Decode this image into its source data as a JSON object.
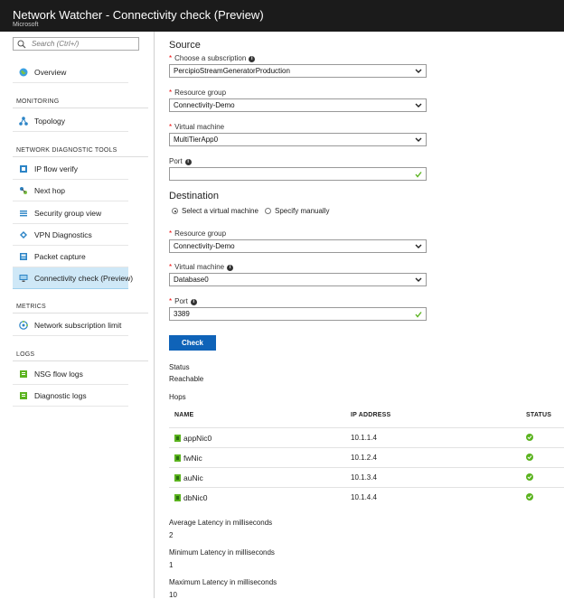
{
  "window": {
    "title": "Network Watcher - Connectivity check (Preview)",
    "subtitle": "Microsoft"
  },
  "sidebar": {
    "search_placeholder": "Search (Ctrl+/)",
    "overview": "Overview",
    "sections": {
      "monitoring": "MONITORING",
      "diagnostic": "NETWORK DIAGNOSTIC TOOLS",
      "metrics": "METRICS",
      "logs": "LOGS"
    },
    "items": {
      "topology": "Topology",
      "ip_flow_verify": "IP flow verify",
      "next_hop": "Next hop",
      "security_group_view": "Security group view",
      "vpn_diagnostics": "VPN Diagnostics",
      "packet_capture": "Packet capture",
      "connectivity_check": "Connectivity check (Preview)",
      "network_subscription_limit": "Network subscription limit",
      "nsg_flow_logs": "NSG flow logs",
      "diagnostic_logs": "Diagnostic logs"
    }
  },
  "source": {
    "heading": "Source",
    "subscription_label": "Choose a subscription",
    "subscription_value": "PercipioStreamGeneratorProduction",
    "resource_group_label": "Resource group",
    "resource_group_value": "Connectivity-Demo",
    "vm_label": "Virtual machine",
    "vm_value": "MultiTierApp0",
    "port_label": "Port",
    "port_value": ""
  },
  "destination": {
    "heading": "Destination",
    "radio_vm": "Select a virtual machine",
    "radio_manual": "Specify manually",
    "resource_group_label": "Resource group",
    "resource_group_value": "Connectivity-Demo",
    "vm_label": "Virtual machine",
    "vm_value": "Database0",
    "port_label": "Port",
    "port_value": "3389"
  },
  "check_button": "Check",
  "results": {
    "status_label": "Status",
    "status_value": "Reachable",
    "hops_label": "Hops",
    "columns": {
      "name": "NAME",
      "ip": "IP ADDRESS",
      "status": "STATUS"
    },
    "hops": [
      {
        "name": "appNic0",
        "ip": "10.1.1.4"
      },
      {
        "name": "fwNic",
        "ip": "10.1.2.4"
      },
      {
        "name": "auNic",
        "ip": "10.1.3.4"
      },
      {
        "name": "dbNic0",
        "ip": "10.1.4.4"
      }
    ],
    "avg_label": "Average Latency in milliseconds",
    "avg_value": "2",
    "min_label": "Minimum Latency in milliseconds",
    "min_value": "1",
    "max_label": "Maximum Latency in milliseconds",
    "max_value": "10"
  },
  "colors": {
    "accent": "#0f63b8",
    "selected_bg": "#cfe8f7",
    "success": "#5bb31f",
    "required": "#ee0000"
  },
  "icons": {
    "search": "search-icon",
    "overview": "globe-icon",
    "topology": "topology-icon",
    "ip_flow": "ip-flow-icon",
    "next_hop": "next-hop-icon",
    "security": "security-group-icon",
    "vpn": "vpn-icon",
    "packet": "packet-capture-icon",
    "connectivity": "monitor-icon",
    "subscription_limit": "network-icon",
    "nsg_logs": "log-icon",
    "diag_logs": "log-icon",
    "status_ok": "check-circle-icon",
    "nic": "nic-icon"
  }
}
